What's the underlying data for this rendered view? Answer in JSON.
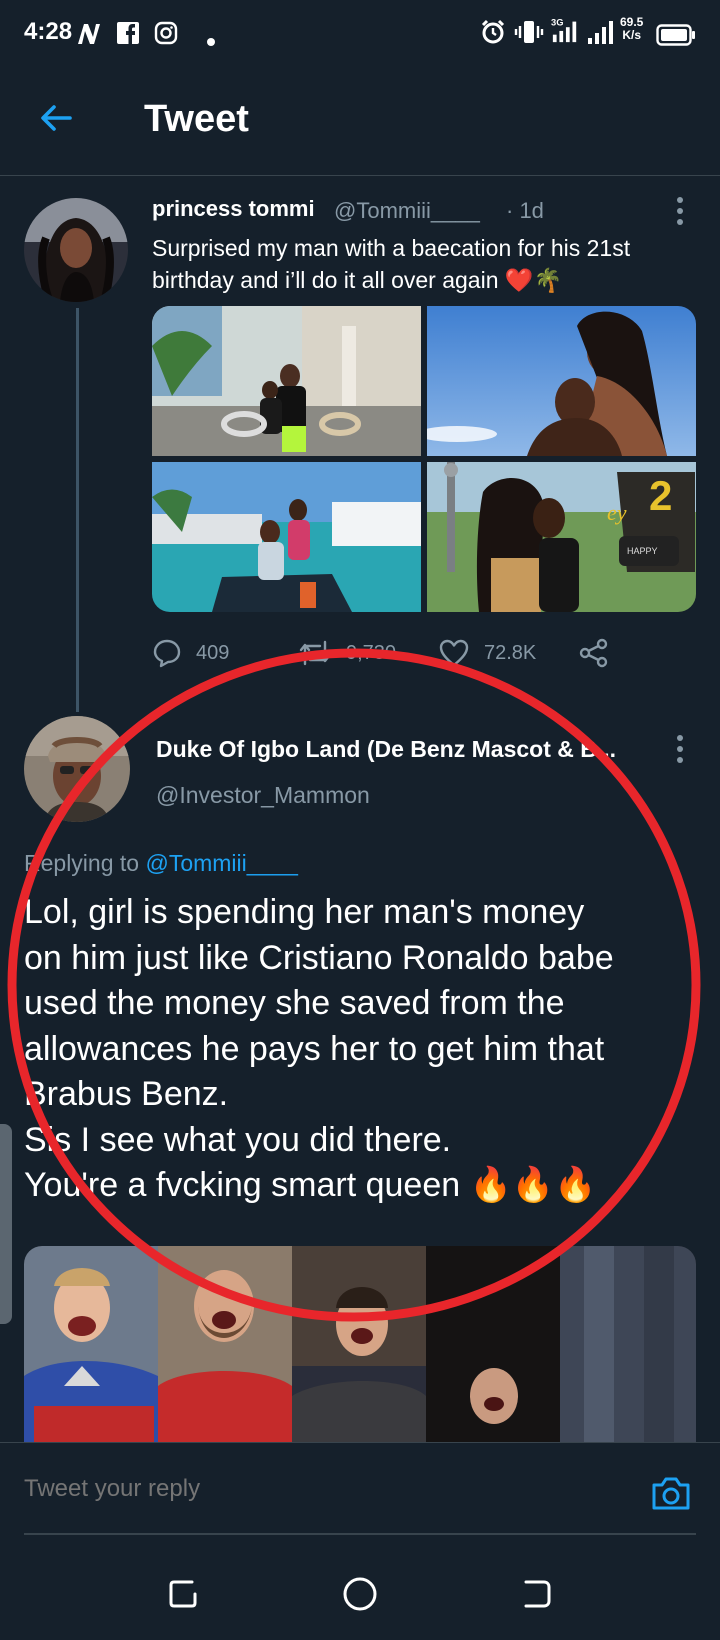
{
  "status_bar": {
    "time": "4:28",
    "network_speed_value": "69.5",
    "network_speed_unit": "K/s",
    "signal_label": "3G"
  },
  "header": {
    "title": "Tweet"
  },
  "tweet_original": {
    "display_name": "princess tommi",
    "handle": "@Tommiii____",
    "time": "· 1d",
    "text": "Surprised my man with a baecation for his 21st birthday and i’ll do it all over again ❤️🌴",
    "actions": {
      "replies": "409",
      "retweets": "9,730",
      "likes": "72.8K"
    }
  },
  "tweet_reply": {
    "display_name": "Duke Of Igbo Land (De Benz Mascot & B...",
    "handle": "@Investor_Mammon",
    "replying_prefix": "Replying to",
    "replying_mention": "@Tommiii____",
    "text_lines": [
      "Lol, girl is spending her man's money",
      "on him just like Cristiano Ronaldo babe",
      "used the money she saved from the",
      "allowances he pays her to get him that",
      "Brabus Benz.",
      "Sis I see what you did there.",
      "You're a fvcking smart queen 🔥🔥🔥"
    ]
  },
  "reply_bar": {
    "placeholder": "Tweet your reply"
  },
  "icons": {
    "back": "arrow-left-icon",
    "more": "more-vertical-icon",
    "reply": "speech-bubble-icon",
    "retweet": "retweet-icon",
    "like": "heart-icon",
    "share": "share-icon",
    "camera": "camera-icon"
  },
  "colors": {
    "background": "#15202b",
    "accent": "#1da1f2",
    "secondary_text": "#8899a6",
    "annotation": "#e8262b"
  }
}
